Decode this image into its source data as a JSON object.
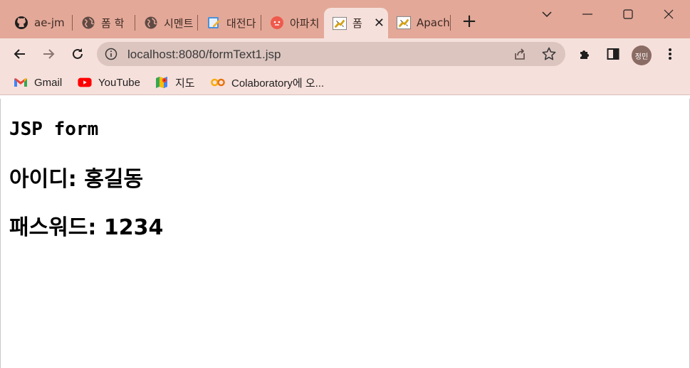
{
  "browser": {
    "tabs": [
      {
        "title": "ae-jm",
        "icon": "github-icon"
      },
      {
        "title": "폼 학",
        "icon": "globe-icon"
      },
      {
        "title": "시멘트",
        "icon": "globe-icon"
      },
      {
        "title": "대전다",
        "icon": "notepad-icon"
      },
      {
        "title": "아파치",
        "icon": "red-circle-icon"
      },
      {
        "title": "폼",
        "icon": "tomcat-icon",
        "active": true
      },
      {
        "title": "Apach",
        "icon": "tomcat-icon"
      }
    ],
    "address": "localhost:8080/formText1.jsp",
    "profile_label": "정민",
    "bookmarks": [
      {
        "label": "Gmail",
        "icon": "gmail-icon"
      },
      {
        "label": "YouTube",
        "icon": "youtube-icon"
      },
      {
        "label": "지도",
        "icon": "maps-icon"
      },
      {
        "label": "Colaboratory에 오...",
        "icon": "colab-icon"
      }
    ]
  },
  "page": {
    "heading": "JSP form",
    "id_line": "아이디: 홍길동",
    "password_line": "패스워드: 1234"
  },
  "colors": {
    "tabstrip": "#e3a898",
    "toolbar": "#f6e0db",
    "omnibox": "#dcc5bf"
  }
}
